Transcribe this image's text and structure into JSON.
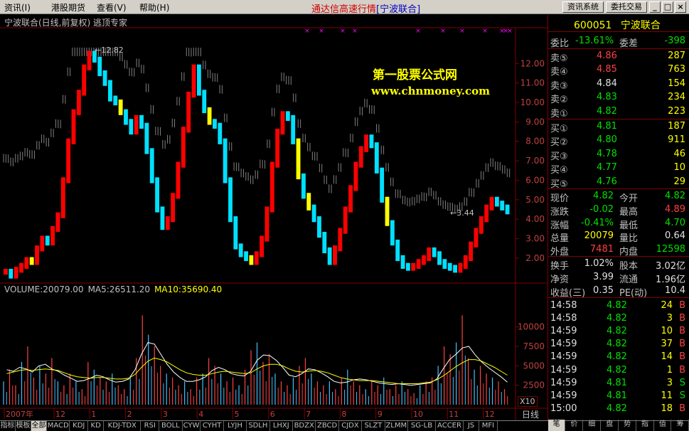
{
  "menu": [
    "资讯(I)",
    "港股期货",
    "查看(V)",
    "帮助(H)"
  ],
  "app_title": "通达信高速行情",
  "app_subtitle": "[宁波联合]",
  "buttons": {
    "news": "资讯系统",
    "trade": "委托交易",
    "min": "_",
    "max": "□",
    "close": "×"
  },
  "stock_title": "宁波联合(日线,前复权) 逃顶专家",
  "watermark": {
    "line1": "第一股票公式网",
    "line2": "www.chnmoney.com"
  },
  "annotations": {
    "high": "12.82",
    "low": "3.44"
  },
  "volume_legend": {
    "volume": "VOLUME:20079.00",
    "ma5": "MA5:26511.20",
    "ma10": "MA10:35690.40"
  },
  "x10": "X10",
  "period": "日线",
  "colors": {
    "up": "#ff0000",
    "down": "#00e0ff",
    "neutral": "#808080",
    "warn": "#ffff00",
    "frame": "#800000"
  },
  "chart_data": [
    {
      "type": "candlestick",
      "title": "宁波联合(日线,前复权) 逃顶专家",
      "y_ticks": [
        "12.00",
        "11.00",
        "10.00",
        "9.00",
        "8.00",
        "7.00",
        "6.00",
        "5.00",
        "4.00",
        "3.00",
        "2.00"
      ],
      "ylim": [
        0.9,
        13.4
      ],
      "x_ticks": [
        "2007年",
        "12",
        "1",
        "2",
        "3",
        "4",
        "5",
        "6",
        "7",
        "8",
        "9",
        "10",
        "11",
        "12"
      ],
      "annotations": [
        {
          "label": "12.82",
          "type": "high"
        },
        {
          "label": "3.44",
          "type": "low"
        }
      ],
      "series": [
        {
          "name": "close",
          "values": [
            1.3,
            1.1,
            1.4,
            1.6,
            1.9,
            1.8,
            2.5,
            3.0,
            2.8,
            3.5,
            4.2,
            6.0,
            8.0,
            9.5,
            10.5,
            11.8,
            12.5,
            12.2,
            11.5,
            11.0,
            10.2,
            10.0,
            9.5,
            9.0,
            8.5,
            9.2,
            8.8,
            7.5,
            6.0,
            4.5,
            3.6,
            4.0,
            5.2,
            6.8,
            8.6,
            10.4,
            11.8,
            10.5,
            9.6,
            9.0,
            8.8,
            8.0,
            6.0,
            4.0,
            2.6,
            2.2,
            2.0,
            1.8,
            2.2,
            3.0,
            4.5,
            6.8,
            8.5,
            9.4,
            9.2,
            8.0,
            6.2,
            5.2,
            4.6,
            4.0,
            3.2,
            2.4,
            1.8,
            2.5,
            3.4,
            4.5,
            5.6,
            6.8,
            7.6,
            8.2,
            7.8,
            6.5,
            5.0,
            3.8,
            2.8,
            2.0,
            1.6,
            1.5,
            1.6,
            1.8,
            2.0,
            2.4,
            2.2,
            1.8,
            1.6,
            1.5,
            1.4,
            1.6,
            2.0,
            2.7,
            3.4,
            4.0,
            4.6,
            5.0,
            4.8,
            4.6,
            4.4
          ]
        }
      ]
    },
    {
      "type": "bar",
      "title": "VOLUME",
      "y_ticks": [
        "10000",
        "7500",
        "5000",
        "2500"
      ],
      "ylim": [
        0,
        14000
      ],
      "series": [
        {
          "name": "VOLUME",
          "values": [
            3000,
            4500,
            2500,
            5500,
            7500,
            3500,
            5000,
            4000,
            6000,
            3000,
            2500,
            4000,
            3000,
            2000,
            5500,
            4500,
            3500,
            3000,
            4000,
            2500,
            2000,
            3500,
            6000,
            11500,
            9000,
            7500,
            5000,
            4000,
            3500,
            2500,
            3000,
            2000,
            3500,
            4000,
            6000,
            5000,
            4000,
            3000,
            3500,
            2500,
            4500,
            7000,
            8000,
            5500,
            6500,
            4000,
            3000,
            2500,
            3500,
            5000,
            6000,
            4000,
            3000,
            2500,
            3000,
            2000,
            3500,
            4500,
            3000,
            2500,
            2000,
            3000,
            2500,
            3500,
            2000,
            2500,
            3000,
            2000,
            1500,
            2500,
            3000,
            3500,
            5000,
            7500,
            6500,
            8000,
            11500,
            6000,
            4500,
            5000,
            4000,
            3500,
            3000,
            2000
          ]
        },
        {
          "name": "MA5",
          "values": [
            4500,
            4300,
            4800,
            4600,
            4200,
            5000,
            5200,
            4600,
            4300,
            3800,
            3400,
            3000,
            3100,
            3400,
            3800,
            3600,
            3200,
            2900,
            3000,
            3300,
            4500,
            6500,
            8000,
            7800,
            6500,
            5200,
            4200,
            3500,
            3000,
            3000,
            3200,
            3600,
            4400,
            4800,
            4500,
            4000,
            3800,
            3700,
            4300,
            5700,
            6400,
            6300,
            5700,
            4800,
            3800,
            3600,
            4000,
            4600,
            4500,
            4100,
            3600,
            3000,
            2800,
            2900,
            3200,
            3300,
            3200,
            3000,
            2800,
            2700,
            2600,
            2700,
            2600,
            2500,
            2600,
            2700,
            2800,
            3300,
            4600,
            5800,
            6500,
            7300,
            7500,
            6400,
            5500,
            4800,
            4200,
            3600,
            2900
          ]
        },
        {
          "name": "MA10",
          "values": [
            4000,
            4200,
            4400,
            4500,
            4400,
            4500,
            4600,
            4500,
            4400,
            4100,
            3800,
            3600,
            3500,
            3400,
            3500,
            3500,
            3400,
            3300,
            3300,
            3400,
            3900,
            4800,
            5600,
            6000,
            5800,
            5500,
            5000,
            4500,
            4100,
            3900,
            3800,
            3800,
            4000,
            4200,
            4300,
            4200,
            4100,
            4000,
            4100,
            4600,
            5000,
            5200,
            5200,
            5000,
            4600,
            4300,
            4200,
            4300,
            4400,
            4300,
            4100,
            3800,
            3500,
            3300,
            3200,
            3100,
            3100,
            3100,
            3000,
            2900,
            2800,
            2700,
            2700,
            2700,
            2700,
            2800,
            2900,
            3200,
            3700,
            4300,
            4900,
            5400,
            5800,
            5800,
            5600,
            5200,
            4800,
            4300,
            3800
          ]
        }
      ]
    }
  ],
  "panel": {
    "code": "600051",
    "name": "宁波联合",
    "weibi": {
      "label": "委比",
      "value": "-13.61%",
      "label2": "委差",
      "value2": "-398"
    },
    "asks": [
      {
        "label": "卖⑤",
        "price": "4.86",
        "vol": "287"
      },
      {
        "label": "卖④",
        "price": "4.85",
        "vol": "763"
      },
      {
        "label": "卖③",
        "price": "4.84",
        "vol": "154"
      },
      {
        "label": "卖②",
        "price": "4.83",
        "vol": "234"
      },
      {
        "label": "卖①",
        "price": "4.82",
        "vol": "223"
      }
    ],
    "bids": [
      {
        "label": "买①",
        "price": "4.81",
        "vol": "187"
      },
      {
        "label": "买②",
        "price": "4.80",
        "vol": "911"
      },
      {
        "label": "买③",
        "price": "4.78",
        "vol": "46"
      },
      {
        "label": "买④",
        "price": "4.77",
        "vol": "10"
      },
      {
        "label": "买⑤",
        "price": "4.76",
        "vol": "29"
      }
    ],
    "stats": [
      {
        "l1": "现价",
        "v1": "4.82",
        "c1": "green",
        "l2": "今开",
        "v2": "4.82",
        "c2": "green"
      },
      {
        "l1": "涨跌",
        "v1": "-0.02",
        "c1": "green",
        "l2": "最高",
        "v2": "4.89",
        "c2": "red"
      },
      {
        "l1": "涨幅",
        "v1": "-0.41%",
        "c1": "green",
        "l2": "最低",
        "v2": "4.70",
        "c2": "green"
      },
      {
        "l1": "总量",
        "v1": "20079",
        "c1": "yellow",
        "l2": "量比",
        "v2": "0.64",
        "c2": "white"
      },
      {
        "l1": "外盘",
        "v1": "7481",
        "c1": "red",
        "l2": "内盘",
        "v2": "12598",
        "c2": "green"
      }
    ],
    "finance": [
      {
        "l1": "换手",
        "v1": "1.02%",
        "l2": "股本",
        "v2": "3.02亿"
      },
      {
        "l1": "净资",
        "v1": "3.99",
        "l2": "流通",
        "v2": "1.96亿"
      },
      {
        "l1": "收益(三)",
        "v1": "0.35",
        "l2": "PE(动)",
        "v2": "10.4"
      }
    ],
    "trades": [
      {
        "time": "14:58",
        "price": "4.82",
        "vol": "24",
        "side": "B"
      },
      {
        "time": "14:58",
        "price": "4.82",
        "vol": "3",
        "side": "B"
      },
      {
        "time": "14:59",
        "price": "4.82",
        "vol": "10",
        "side": "B"
      },
      {
        "time": "14:59",
        "price": "4.82",
        "vol": "37",
        "side": "B"
      },
      {
        "time": "14:59",
        "price": "4.82",
        "vol": "14",
        "side": "B"
      },
      {
        "time": "14:59",
        "price": "4.82",
        "vol": "1",
        "side": "B"
      },
      {
        "time": "14:59",
        "price": "4.81",
        "vol": "3",
        "side": "S"
      },
      {
        "time": "14:59",
        "price": "4.81",
        "vol": "11",
        "side": "S"
      },
      {
        "time": "15:00",
        "price": "4.82",
        "vol": "18",
        "side": "B"
      }
    ],
    "tabs": [
      "笔",
      "价",
      "细",
      "盘",
      "势",
      "指",
      "值",
      "筹"
    ]
  },
  "bottom_tabs": [
    "指标",
    "模板",
    "全部",
    "MACD",
    "KDJ",
    "KD",
    "KDJ-TDX",
    "RSI",
    "BOLL",
    "CYW",
    "CYHT",
    "LYJH",
    "SDLH",
    "LHXJ",
    "BDZX",
    "ZBCD",
    "CJDX",
    "SLZT",
    "ZLMM",
    "SG-LB",
    "ACCER",
    "JS",
    "MFI"
  ]
}
